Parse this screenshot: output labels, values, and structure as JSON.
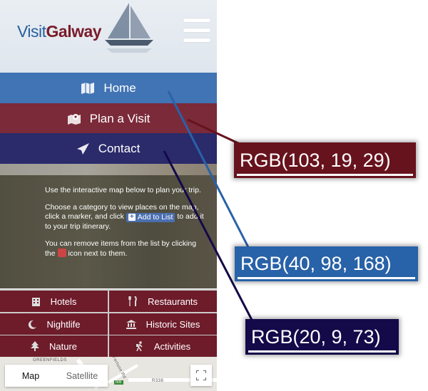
{
  "header": {
    "logo_part1": "Visit",
    "logo_part2": "Galway"
  },
  "nav": [
    {
      "label": "Home",
      "icon": "map-book-icon"
    },
    {
      "label": "Plan a Visit",
      "icon": "map-marker-icon"
    },
    {
      "label": "Contact",
      "icon": "paper-plane-icon"
    }
  ],
  "hero": {
    "para1": "Use the interactive map below to plan your trip.",
    "para2_pre": "Choose a category to view places on the map, click a marker, and click",
    "add_to_list": "Add to List",
    "para2_post": "to add it to your trip itinerary.",
    "para3_pre": "You can remove items from the list by clicking the",
    "para3_post": "icon next to them."
  },
  "categories": [
    {
      "label": "Hotels",
      "icon": "building-icon"
    },
    {
      "label": "Restaurants",
      "icon": "cutlery-icon"
    },
    {
      "label": "Nightlife",
      "icon": "moon-icon"
    },
    {
      "label": "Historic Sites",
      "icon": "bank-icon"
    },
    {
      "label": "Nature",
      "icon": "tree-icon"
    },
    {
      "label": "Activities",
      "icon": "hiking-icon"
    }
  ],
  "map": {
    "map_label": "Map",
    "satellite_label": "Satellite",
    "place_label": "GREENFIELDS",
    "road_label": "R338",
    "road_label2": "Fortune Rd",
    "badge": "N6"
  },
  "annotations": [
    {
      "text": "RGB(103, 19, 29)",
      "color": "#67131d",
      "target": "Plan a Visit"
    },
    {
      "text": "RGB(40, 98, 168)",
      "color": "#2862a8",
      "target": "Home"
    },
    {
      "text": "RGB(20, 9, 73)",
      "color": "#140949",
      "target": "Contact"
    }
  ],
  "colors": {
    "home_bg": "#4174b4",
    "plan_bg": "#7b2a3a",
    "contact_bg": "#2b2a6a",
    "category_bg": "#6e1b2a"
  }
}
